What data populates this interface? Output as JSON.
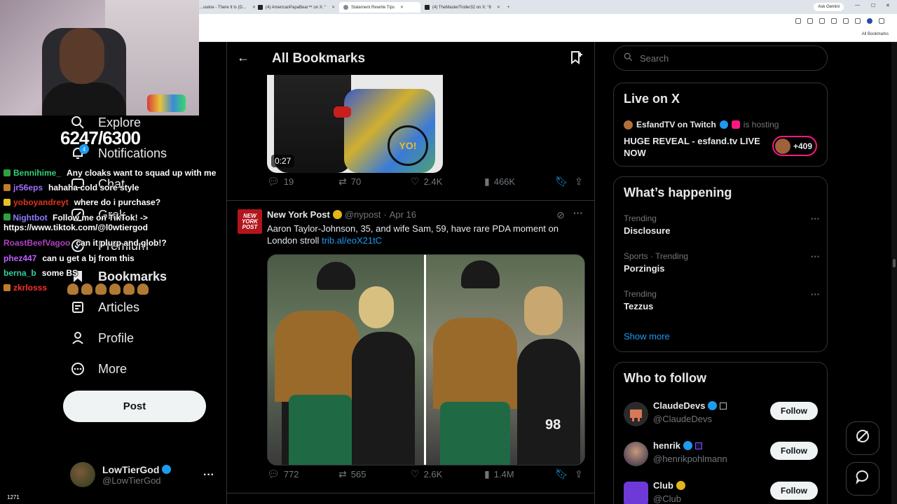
{
  "browser": {
    "tabs": [
      {
        "label": "…uwine - There It Is (D…"
      },
      {
        "label": "(4) AmericanPapaBear™ on X: \""
      },
      {
        "label": "Statement Rewrite Tips"
      },
      {
        "label": "(4) TheMasterTroller32 on X: \"8"
      }
    ],
    "ask_gemini": "Ask Gemini",
    "all_bookmarks": "All Bookmarks"
  },
  "overlay": {
    "sub_counter": "6247/6300",
    "viewer_count": "1271",
    "notif_count": "4",
    "chat": [
      {
        "user": "Bennihime_",
        "user_color": "#33d17a",
        "message": "Any cloaks want to squad up with me"
      },
      {
        "user": "jr56eps",
        "user_color": "#a070ff",
        "message": "hahaha cold sore style"
      },
      {
        "user": "yoboyandreyt",
        "user_color": "#e0341c",
        "message": "where do i purchase?"
      },
      {
        "user": "Nightbot",
        "user_color": "#8a7cff",
        "message": "Follow me on TikTok! -> https://www.tiktok.com/@l0wtiergod"
      },
      {
        "user": "RoastBeefVagoo",
        "user_color": "#b040c0",
        "message": "can it plurp and glob!?"
      },
      {
        "user": "phez447",
        "user_color": "#c060ff",
        "message": "can u get a bj from this"
      },
      {
        "user": "berna_b",
        "user_color": "#30d0a0",
        "message": "some BS"
      },
      {
        "user": "zkrlosss",
        "user_color": "#ff3030",
        "message": ""
      }
    ]
  },
  "sidebar": {
    "nav": [
      {
        "label": "Explore",
        "icon": "search-icon"
      },
      {
        "label": "Notifications",
        "icon": "bell-icon"
      },
      {
        "label": "Chat",
        "icon": "chat-icon"
      },
      {
        "label": "Grok",
        "icon": "grok-icon"
      },
      {
        "label": "Premium",
        "icon": "premium-icon"
      },
      {
        "label": "Bookmarks",
        "icon": "bookmark-icon"
      },
      {
        "label": "Articles",
        "icon": "article-icon"
      },
      {
        "label": "Profile",
        "icon": "person-icon"
      },
      {
        "label": "More",
        "icon": "more-circle-icon"
      }
    ],
    "post_label": "Post",
    "account": {
      "name": "LowTierGod",
      "handle": "@LowTierGod",
      "more": "···"
    }
  },
  "main": {
    "title": "All Bookmarks",
    "tweet1": {
      "duration": "0:27",
      "video_logo": "YO!",
      "stats": {
        "replies": "19",
        "reposts": "70",
        "likes": "2.4K",
        "views": "466K"
      }
    },
    "tweet2": {
      "avatar_text": "NEW YORK POST",
      "author": "New York Post",
      "handle": "@nypost",
      "date": "Apr 16",
      "text": "Aaron Taylor-Johnson, 35, and wife Sam, 59, have rare PDA moment on London stroll",
      "link": "trib.al/eoX21tC",
      "jersey_number": "98",
      "stats": {
        "replies": "772",
        "reposts": "565",
        "likes": "2.6K",
        "views": "1.4M"
      }
    }
  },
  "right": {
    "search_placeholder": "Search",
    "live": {
      "title": "Live on X",
      "host": "EsfandTV on Twitch",
      "hosting": "is hosting",
      "stream_title": "HUGE REVEAL - esfand.tv LIVE NOW",
      "listeners": "+409"
    },
    "happening": {
      "title": "What’s happening",
      "trends": [
        {
          "context": "Trending",
          "topic": "Disclosure"
        },
        {
          "context": "Sports · Trending",
          "topic": "Porzingis"
        },
        {
          "context": "Trending",
          "topic": "Tezzus"
        }
      ],
      "show_more": "Show more"
    },
    "who_to_follow": {
      "title": "Who to follow",
      "accounts": [
        {
          "name": "ClaudeDevs",
          "handle": "@ClaudeDevs",
          "button": "Follow"
        },
        {
          "name": "henrik",
          "handle": "@henrikpohlmann",
          "button": "Follow"
        },
        {
          "name": "Club",
          "handle": "@Club",
          "button": "Follow"
        }
      ]
    }
  },
  "colors": {
    "accent": "#1d9bf0",
    "background": "#000000",
    "border": "#2f3336",
    "muted": "#71767b",
    "live_pink": "#f91880"
  }
}
